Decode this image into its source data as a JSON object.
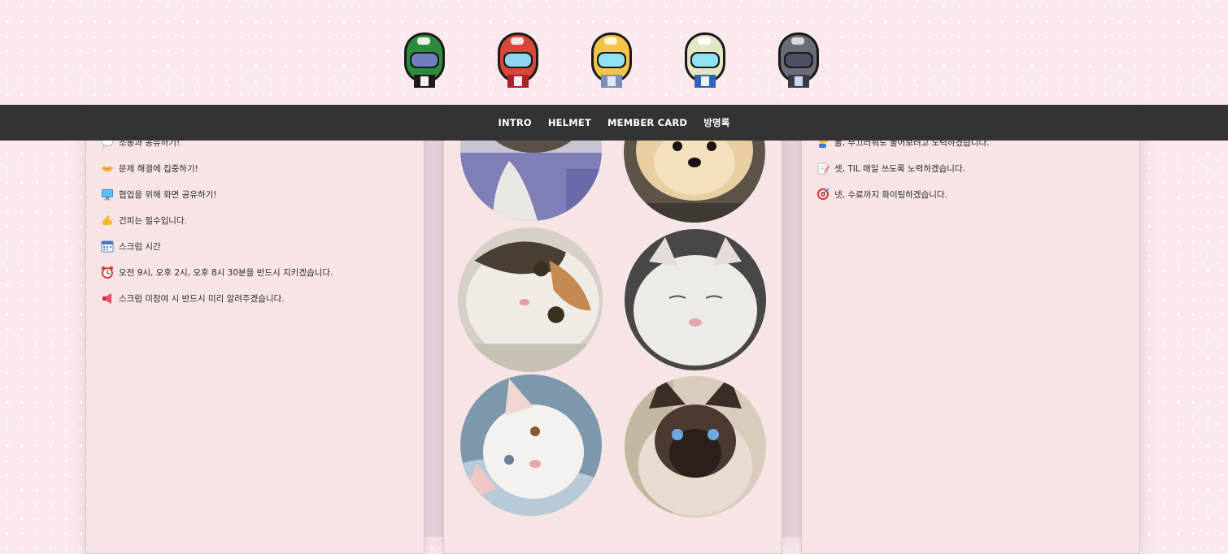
{
  "nav": {
    "items": [
      {
        "label": "INTRO"
      },
      {
        "label": "HELMET"
      },
      {
        "label": "MEMBER CARD"
      },
      {
        "label": "방명록"
      }
    ]
  },
  "helmets": [
    {
      "name": "green-helmet-icon",
      "color": "#2e8b3e"
    },
    {
      "name": "red-helmet-icon",
      "color": "#d9473a"
    },
    {
      "name": "yellow-helmet-icon",
      "color": "#f3c447"
    },
    {
      "name": "cream-helmet-icon",
      "color": "#e3e6c4"
    },
    {
      "name": "gray-helmet-icon",
      "color": "#6b6c78"
    }
  ],
  "left_panel": {
    "items": [
      {
        "icon": "speech-bubble-icon",
        "text": "소통과 공유하기!"
      },
      {
        "icon": "handshake-icon",
        "text": "문제 해결에 집중하기!"
      },
      {
        "icon": "monitor-icon",
        "text": "협업을 위해 화면 공유하기!"
      },
      {
        "icon": "flexed-bicep-icon",
        "text": "건피는 필수입니다."
      },
      {
        "icon": "calendar-icon",
        "text": "스크럼 시간"
      },
      {
        "icon": "alarm-clock-icon",
        "text": "오전 9시, 오후 2시, 오후 8시 30분을 반드시 지키겠습니다."
      },
      {
        "icon": "megaphone-icon",
        "text": "스크럼 미참여 시 반드시 미리 알려주겠습니다."
      }
    ]
  },
  "right_panel": {
    "items": [
      {
        "icon": "raising-hand-icon",
        "text": "둘, 부끄러워도 물어보려고 노력하겠습니다."
      },
      {
        "icon": "memo-icon",
        "text": "셋, TIL 매일 쓰도록 노력하겠습니다."
      },
      {
        "icon": "target-icon",
        "text": "넷, 수료까지 화이팅하겠습니다."
      }
    ]
  },
  "photos": [
    {
      "name": "pet-photo-1",
      "subject": "dog-photo"
    },
    {
      "name": "pet-photo-2",
      "subject": "pomeranian-photo"
    },
    {
      "name": "pet-photo-3",
      "subject": "calico-cat-photo"
    },
    {
      "name": "pet-photo-4",
      "subject": "white-cat-photo"
    },
    {
      "name": "pet-photo-5",
      "subject": "white-kitten-photo"
    },
    {
      "name": "pet-photo-6",
      "subject": "siamese-cat-photo"
    }
  ],
  "colors": {
    "nav_bg": "#333333",
    "panel_bg": "#f7e4e4",
    "page_bg": "#fbe9ee"
  }
}
